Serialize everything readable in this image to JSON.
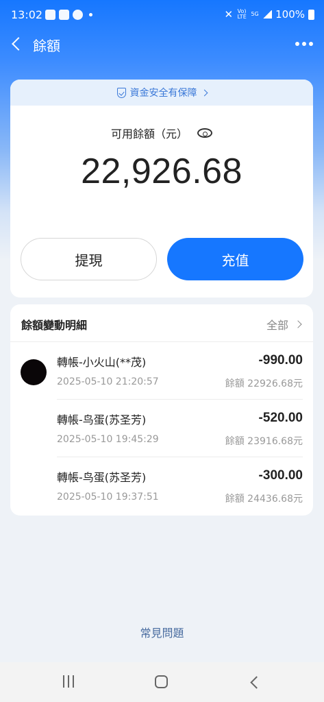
{
  "status_bar": {
    "time": "13:02",
    "network_lte": "Vo) LTE",
    "network_5g": "5G",
    "battery": "100%"
  },
  "header": {
    "title": "餘額",
    "back_icon": "chevron-left-icon",
    "more_icon": "more-horizontal-icon"
  },
  "balance_card": {
    "security_notice": "資金安全有保障",
    "balance_label": "可用餘額（元）",
    "balance_amount": "22,926.68",
    "withdraw_label": "提現",
    "recharge_label": "充值"
  },
  "details": {
    "title": "餘額變動明細",
    "all_label": "全部",
    "transactions": [
      {
        "name": "轉帳-小火山(**茂)",
        "datetime": "2025-05-10 21:20:57",
        "amount": "-990.00",
        "balance": "餘額 22926.68元"
      },
      {
        "name": "轉帳-鸟蛋(苏圣芳)",
        "datetime": "2025-05-10 19:45:29",
        "amount": "-520.00",
        "balance": "餘額 23916.68元"
      },
      {
        "name": "轉帳-鸟蛋(苏圣芳)",
        "datetime": "2025-05-10 19:37:51",
        "amount": "-300.00",
        "balance": "餘額 24436.68元"
      }
    ]
  },
  "faq_label": "常見問題",
  "colors": {
    "primary": "#1677ff",
    "security_text": "#3a78d8",
    "faq_text": "#4a6da0"
  }
}
